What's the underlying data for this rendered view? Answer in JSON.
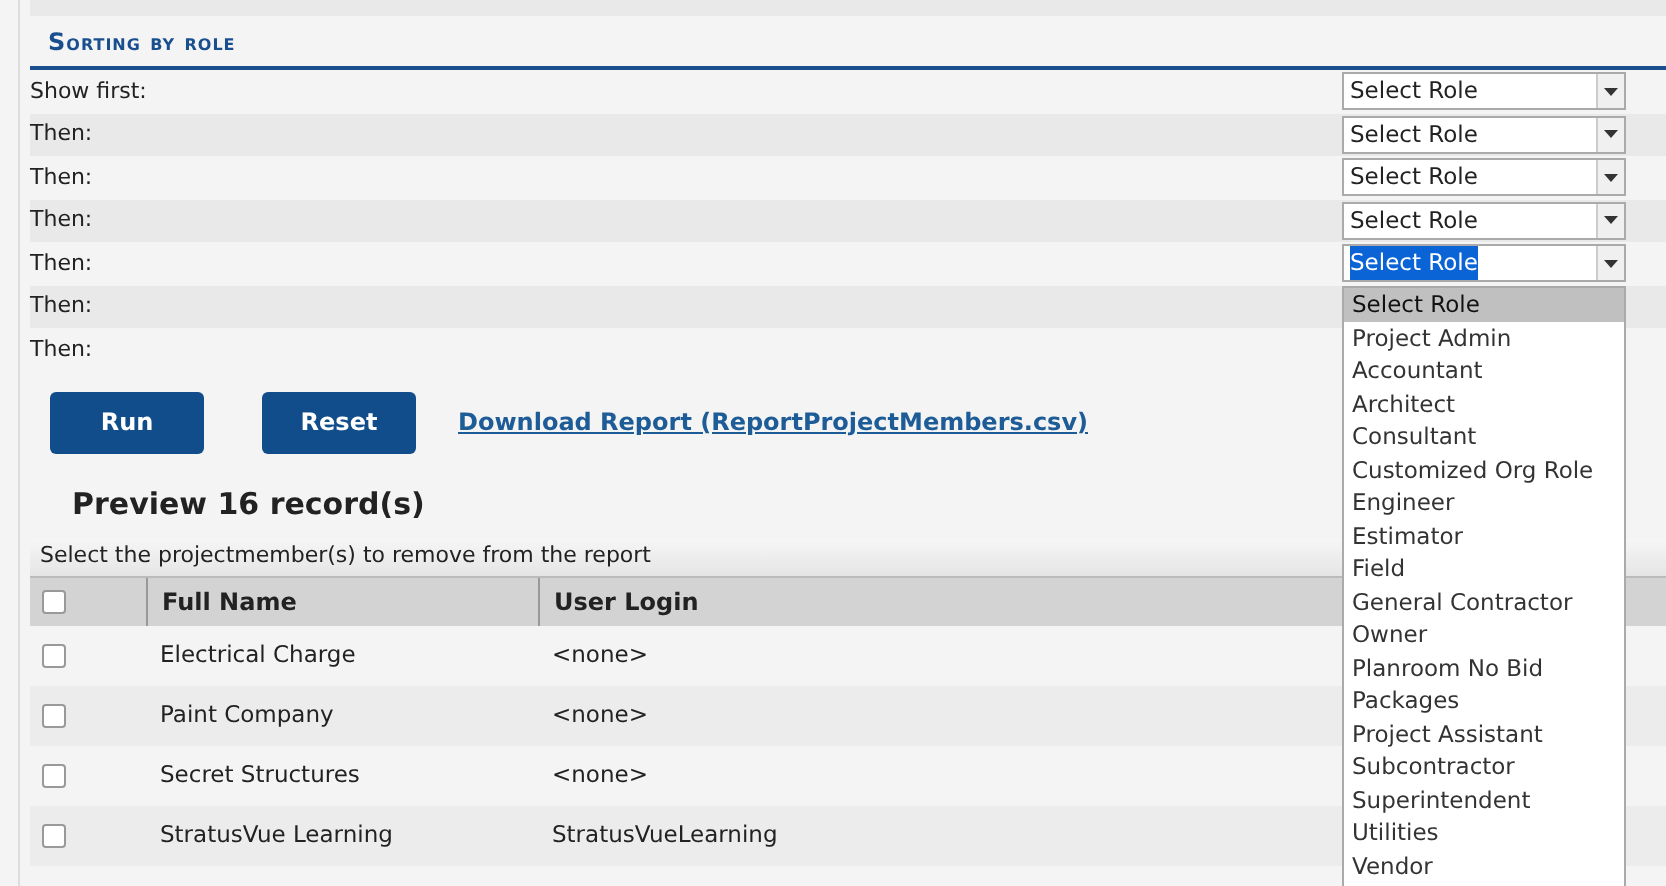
{
  "section_title": "Sorting by role",
  "sort_rows": [
    {
      "label": "Show first:",
      "value": "Select Role",
      "open": false
    },
    {
      "label": "Then:",
      "value": "Select Role",
      "open": false
    },
    {
      "label": "Then:",
      "value": "Select Role",
      "open": false
    },
    {
      "label": "Then:",
      "value": "Select Role",
      "open": false
    },
    {
      "label": "Then:",
      "value": "Select Role",
      "open": true
    },
    {
      "label": "Then:"
    },
    {
      "label": "Then:"
    }
  ],
  "dropdown_options": [
    {
      "label": "Select Role",
      "selected": true
    },
    {
      "label": "Project Admin",
      "selected": false
    },
    {
      "label": "Accountant",
      "selected": false
    },
    {
      "label": "Architect",
      "selected": false
    },
    {
      "label": "Consultant",
      "selected": false
    },
    {
      "label": "Customized Org Role",
      "selected": false
    },
    {
      "label": "Engineer",
      "selected": false
    },
    {
      "label": "Estimator",
      "selected": false
    },
    {
      "label": "Field",
      "selected": false
    },
    {
      "label": "General Contractor",
      "selected": false
    },
    {
      "label": "Owner",
      "selected": false
    },
    {
      "label": "Planroom No Bid Packages",
      "selected": false
    },
    {
      "label": "Project Assistant",
      "selected": false
    },
    {
      "label": "Subcontractor",
      "selected": false
    },
    {
      "label": "Superintendent",
      "selected": false
    },
    {
      "label": "Utilities",
      "selected": false
    },
    {
      "label": "Vendor",
      "selected": false
    }
  ],
  "buttons": [
    "Run",
    "Reset"
  ],
  "download_link": "Download Report (ReportProjectMembers.csv)",
  "preview_title": "Preview 16 record(s)",
  "instruction": "Select the projectmember(s) to remove from the report",
  "table": {
    "select_all_checked": false,
    "columns": [
      "Full Name",
      "User Login"
    ],
    "rows": [
      {
        "checked": false,
        "cells": [
          "Electrical Charge",
          "<none>"
        ]
      },
      {
        "checked": false,
        "cells": [
          "Paint Company",
          "<none>"
        ]
      },
      {
        "checked": false,
        "cells": [
          "Secret Structures",
          "<none>"
        ]
      },
      {
        "checked": false,
        "cells": [
          "StratusVue Learning",
          "StratusVueLearning"
        ]
      }
    ]
  }
}
